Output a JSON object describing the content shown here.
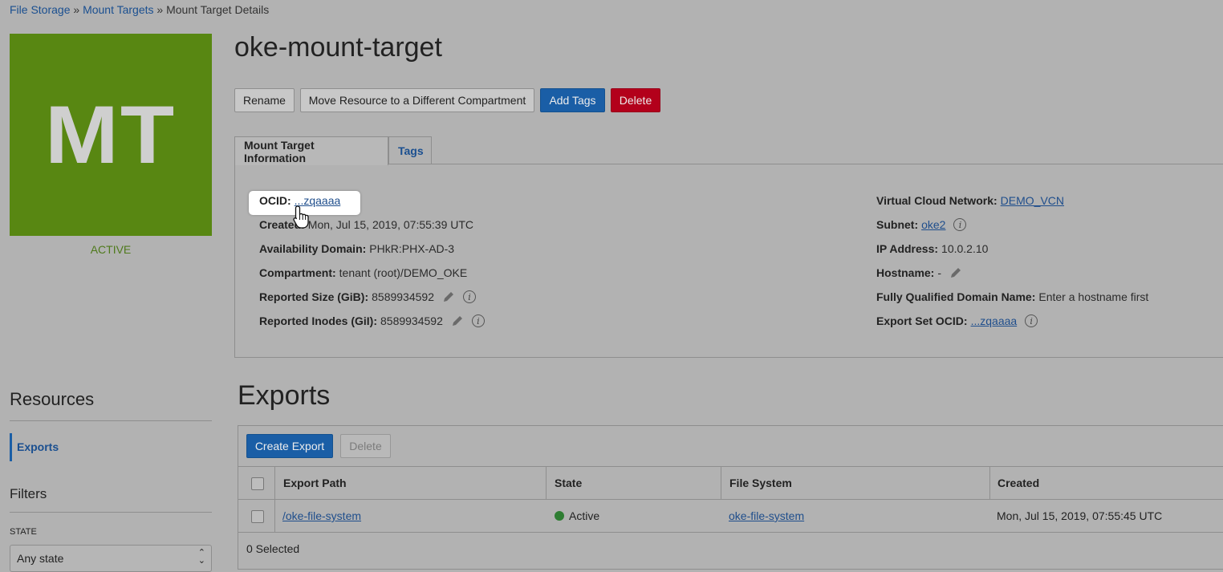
{
  "breadcrumb": {
    "items": [
      "File Storage",
      "Mount Targets",
      "Mount Target Details"
    ],
    "separator": "»"
  },
  "badge": {
    "initials": "MT",
    "color": "#588712"
  },
  "status": "ACTIVE",
  "title": "oke-mount-target",
  "actions": {
    "rename": "Rename",
    "move": "Move Resource to a Different Compartment",
    "add_tags": "Add Tags",
    "delete": "Delete"
  },
  "tabs": {
    "info": "Mount Target Information",
    "tags": "Tags"
  },
  "info_left": {
    "ocid_label": "OCID:",
    "ocid_value": "...zqaaaa",
    "created_label": "Created:",
    "created_value": "Mon, Jul 15, 2019, 07:55:39 UTC",
    "ad_label": "Availability Domain:",
    "ad_value": "PHkR:PHX-AD-3",
    "compartment_label": "Compartment:",
    "compartment_value": "tenant (root)/DEMO_OKE",
    "size_label": "Reported Size (GiB):",
    "size_value": "8589934592",
    "inodes_label": "Reported Inodes (GiI):",
    "inodes_value": "8589934592"
  },
  "info_right": {
    "vcn_label": "Virtual Cloud Network:",
    "vcn_value": "DEMO_VCN",
    "subnet_label": "Subnet:",
    "subnet_value": "oke2",
    "ip_label": "IP Address:",
    "ip_value": "10.0.2.10",
    "hostname_label": "Hostname:",
    "hostname_value": "-",
    "fqdn_label": "Fully Qualified Domain Name:",
    "fqdn_value": "Enter a hostname first",
    "export_set_label": "Export Set OCID:",
    "export_set_value": "...zqaaaa"
  },
  "sidebar": {
    "resources_title": "Resources",
    "resources_items": [
      "Exports"
    ],
    "filters_title": "Filters",
    "state_label": "STATE",
    "state_value": "Any state"
  },
  "exports": {
    "title": "Exports",
    "create_label": "Create Export",
    "delete_label": "Delete",
    "columns": [
      "Export Path",
      "State",
      "File System",
      "Created"
    ],
    "rows": [
      {
        "path": "/oke-file-system",
        "state": "Active",
        "file_system": "oke-file-system",
        "created": "Mon, Jul 15, 2019, 07:55:45 UTC"
      }
    ],
    "footer": "0 Selected"
  },
  "colors": {
    "primary": "#1a5ea6",
    "danger": "#b3001b",
    "active_dot": "#2e7d32"
  }
}
